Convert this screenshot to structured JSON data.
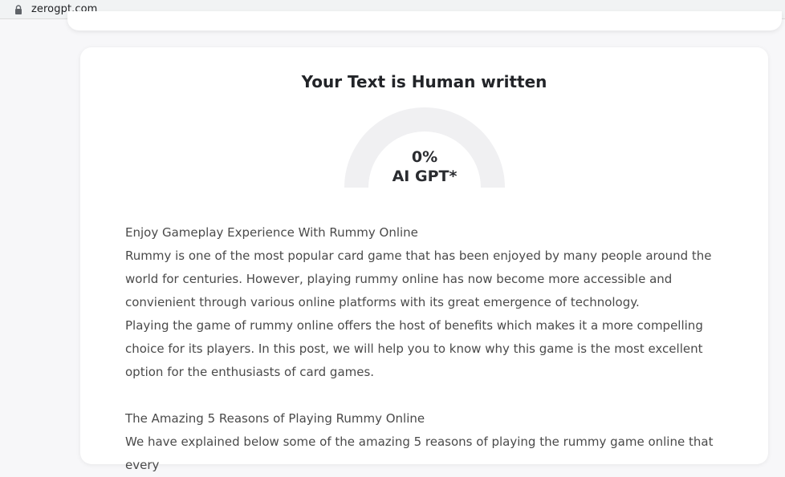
{
  "browser": {
    "url": "zerogpt.com",
    "lock_icon": "lock-icon"
  },
  "result": {
    "title": "Your Text is Human written",
    "percent": "0%",
    "percent_value": 0,
    "label": "AI GPT*",
    "gauge_track_color": "#f0f0f2"
  },
  "content": {
    "paragraphs": [
      "Enjoy Gameplay Experience With Rummy Online",
      "Rummy is one of the most popular card game that has been enjoyed by many people around the world for centuries. However, playing rummy online has now become more accessible and convienient through various online platforms with its great emergence of technology.",
      "Playing the game of rummy online offers the host of benefits which makes it a more compelling choice for its players. In this post, we will help you to know why this game is the most excellent option for the enthusiasts of card games.",
      "",
      "The Amazing 5 Reasons of Playing Rummy Online",
      "We have explained below some of the amazing 5 reasons of playing the rummy game online that every"
    ]
  }
}
